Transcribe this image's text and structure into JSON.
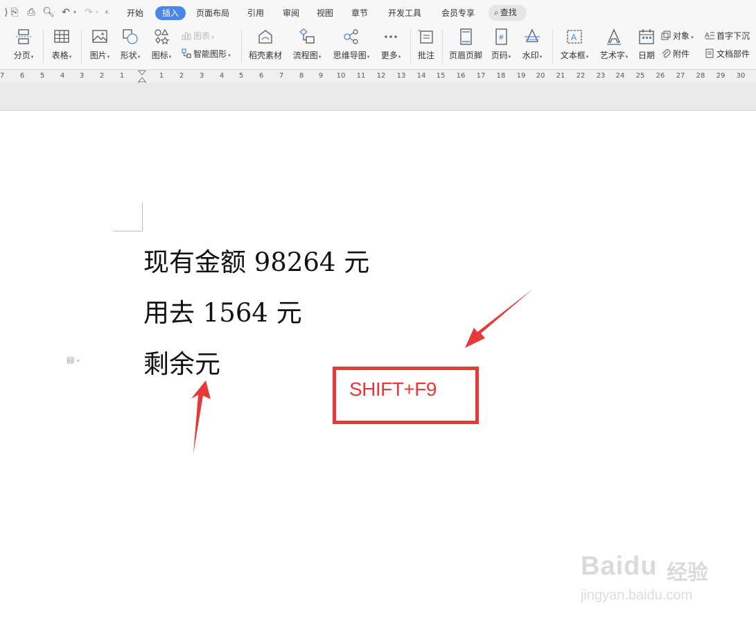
{
  "menu": {
    "tabs": [
      "开始",
      "插入",
      "页面布局",
      "引用",
      "审阅",
      "视图",
      "章节",
      "开发工具",
      "会员专享"
    ],
    "active_tab": "插入",
    "search_label": "查找"
  },
  "ribbon": {
    "page_break": "分页",
    "table": "表格",
    "picture": "图片",
    "shape": "形状",
    "icons": "图标",
    "chart": "图表",
    "smart_graphic": "智能图形",
    "daoke_material": "稻壳素材",
    "flowchart": "流程图",
    "mindmap": "思维导图",
    "more": "更多",
    "comment": "批注",
    "header_footer": "页眉页脚",
    "page_number": "页码",
    "watermark": "水印",
    "text_box": "文本框",
    "word_art": "艺术字",
    "date": "日期",
    "object": "对象",
    "attachment": "附件",
    "drop_cap": "首字下沉",
    "doc_parts": "文档部件"
  },
  "ruler": {
    "numbers": [
      "7",
      "6",
      "5",
      "4",
      "3",
      "2",
      "1",
      "1",
      "2",
      "3",
      "4",
      "5",
      "6",
      "7",
      "8",
      "9",
      "10",
      "11",
      "12",
      "13",
      "14",
      "15",
      "16",
      "17",
      "18",
      "19",
      "20",
      "21",
      "22",
      "23",
      "24",
      "25",
      "26",
      "27",
      "28",
      "29",
      "30"
    ]
  },
  "document": {
    "line1": "现有金额 98264 元",
    "line2": "用去 1564 元",
    "line3": "剩余元"
  },
  "annotation": {
    "shortcut": "SHIFT+F9",
    "color": "#e63a3a"
  },
  "watermark": {
    "brand": "Baidu",
    "brand_cn": "经验",
    "url": "jingyan.baidu.com"
  }
}
